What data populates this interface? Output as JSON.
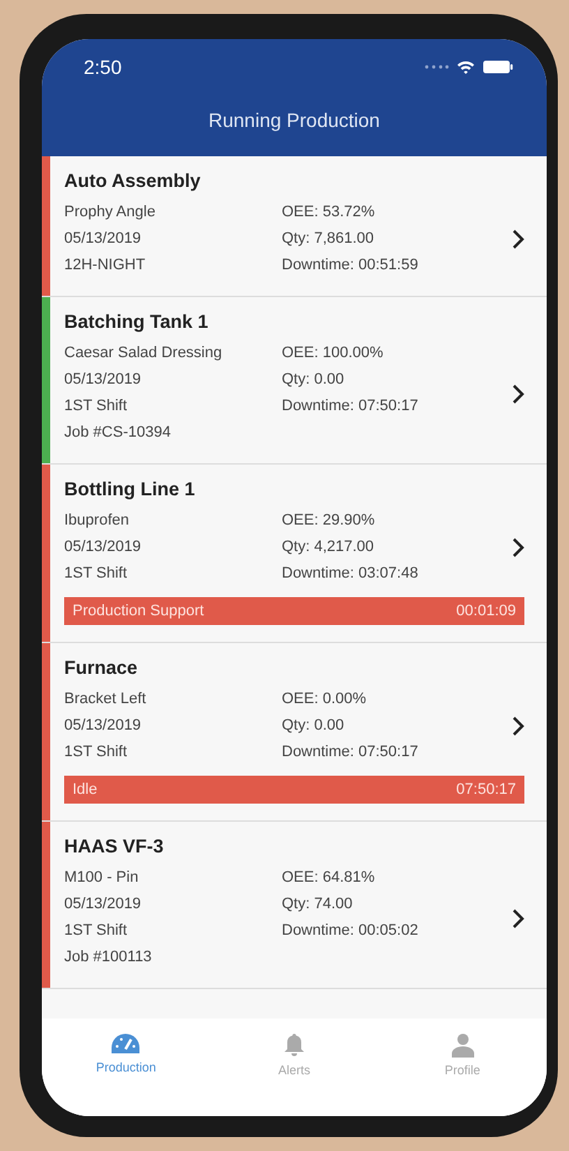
{
  "status_bar": {
    "time": "2:50"
  },
  "header": {
    "title": "Running Production"
  },
  "machines": [
    {
      "name": "Auto Assembly",
      "color": "#e05a4a",
      "product": "Prophy Angle",
      "date": "05/13/2019",
      "shift": "12H-NIGHT",
      "oee": "OEE: 53.72%",
      "qty": "Qty: 7,861.00",
      "downtime": "Downtime: 00:51:59"
    },
    {
      "name": "Batching Tank 1",
      "color": "#4caf50",
      "product": "Caesar Salad Dressing",
      "date": "05/13/2019",
      "shift": "1ST Shift",
      "job": "Job #CS-10394",
      "oee": "OEE: 100.00%",
      "qty": "Qty: 0.00",
      "downtime": "Downtime: 07:50:17"
    },
    {
      "name": "Bottling Line 1",
      "color": "#e05a4a",
      "product": "Ibuprofen",
      "date": "05/13/2019",
      "shift": "1ST Shift",
      "oee": "OEE: 29.90%",
      "qty": "Qty: 4,217.00",
      "downtime": "Downtime: 03:07:48",
      "alert": {
        "label": "Production Support",
        "time": "00:01:09"
      }
    },
    {
      "name": "Furnace",
      "color": "#e05a4a",
      "product": "Bracket Left",
      "date": "05/13/2019",
      "shift": "1ST Shift",
      "oee": "OEE: 0.00%",
      "qty": "Qty: 0.00",
      "downtime": "Downtime: 07:50:17",
      "alert": {
        "label": "Idle",
        "time": "07:50:17"
      }
    },
    {
      "name": "HAAS VF-3",
      "color": "#e05a4a",
      "product": "M100 - Pin",
      "date": "05/13/2019",
      "shift": "1ST Shift",
      "job": "Job #100113",
      "oee": "OEE: 64.81%",
      "qty": "Qty: 74.00",
      "downtime": "Downtime: 00:05:02"
    }
  ],
  "tabs": [
    {
      "label": "Production",
      "kind": "gauge",
      "selected": true
    },
    {
      "label": "Alerts",
      "kind": "bell",
      "selected": false
    },
    {
      "label": "Profile",
      "kind": "person",
      "selected": false
    }
  ]
}
